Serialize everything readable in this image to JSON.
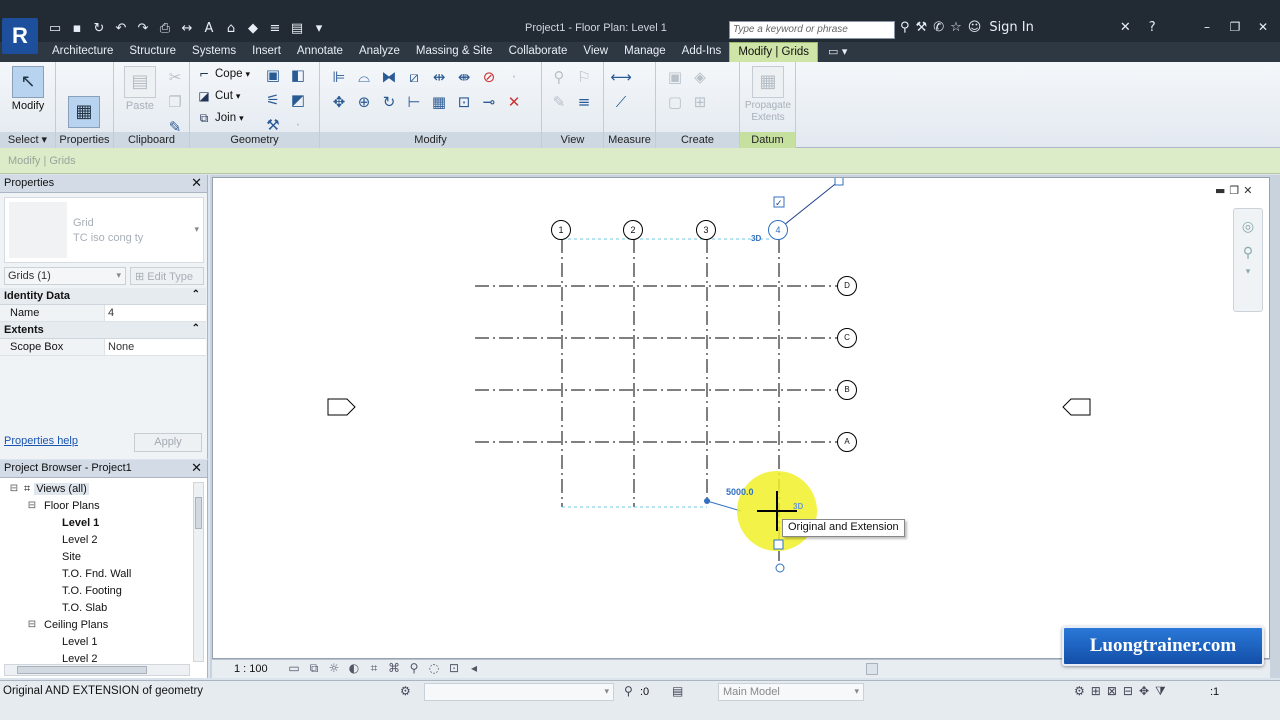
{
  "app": {
    "title": "Project1 - Floor Plan: Level 1",
    "logo": "R",
    "search_placeholder": "Type a keyword or phrase",
    "sign_in": "Sign In",
    "accent": "#cfe5a8"
  },
  "ribbon_tabs": [
    "Architecture",
    "Structure",
    "Systems",
    "Insert",
    "Annotate",
    "Analyze",
    "Massing & Site",
    "Collaborate",
    "View",
    "Manage",
    "Add-Ins",
    "Modify | Grids"
  ],
  "ribbon": {
    "select": {
      "modify_label": "Modify",
      "panel": "Select ▾"
    },
    "properties": {
      "panel": "Properties"
    },
    "clipboard": {
      "paste_label": "Paste",
      "panel": "Clipboard"
    },
    "geometry": {
      "cope": "Cope",
      "cut": "Cut",
      "join": "Join",
      "panel": "Geometry"
    },
    "modify": {
      "panel": "Modify"
    },
    "view": {
      "panel": "View"
    },
    "measure": {
      "panel": "Measure"
    },
    "create": {
      "panel": "Create"
    },
    "datum": {
      "propagate_label": "Propagate Extents",
      "panel": "Datum"
    }
  },
  "options_bar": {
    "text": "Modify | Grids"
  },
  "properties": {
    "header": "Properties",
    "type_family": "Grid",
    "type_name": "TC iso cong ty",
    "instance_selector": "Grids (1)",
    "edit_type": "Edit Type",
    "groups": [
      {
        "name": "Identity Data",
        "rows": [
          {
            "key": "Name",
            "value": "4"
          }
        ]
      },
      {
        "name": "Extents",
        "rows": [
          {
            "key": "Scope Box",
            "value": "None"
          }
        ]
      }
    ],
    "help_link": "Properties help",
    "apply_label": "Apply"
  },
  "project_browser": {
    "header": "Project Browser - Project1",
    "items": [
      {
        "label": "Views (all)",
        "toggle": "⊟",
        "indent": 0
      },
      {
        "label": "Floor Plans",
        "toggle": "⊟",
        "indent": 1
      },
      {
        "label": "Level 1",
        "toggle": "",
        "indent": 2,
        "bold": true
      },
      {
        "label": "Level 2",
        "toggle": "",
        "indent": 2
      },
      {
        "label": "Site",
        "toggle": "",
        "indent": 2
      },
      {
        "label": "T.O. Fnd. Wall",
        "toggle": "",
        "indent": 2
      },
      {
        "label": "T.O. Footing",
        "toggle": "",
        "indent": 2
      },
      {
        "label": "T.O. Slab",
        "toggle": "",
        "indent": 2
      },
      {
        "label": "Ceiling Plans",
        "toggle": "⊟",
        "indent": 1
      },
      {
        "label": "Level 1",
        "toggle": "",
        "indent": 2
      },
      {
        "label": "Level 2",
        "toggle": "",
        "indent": 2
      }
    ]
  },
  "drawing": {
    "vertical_grids": [
      "1",
      "2",
      "3",
      "4"
    ],
    "horizontal_grids": [
      "D",
      "C",
      "B",
      "A"
    ],
    "dimension_value": "5000.0",
    "tag_3d": "3D",
    "tooltip": "Original and Extension",
    "scale": "1 : 100"
  },
  "status_bar": {
    "message": "Original AND EXTENSION  of geometry",
    "workset_count": ":0",
    "model": "Main Model",
    "filter_count": ":1"
  },
  "watermark": "Luongtrainer.com"
}
